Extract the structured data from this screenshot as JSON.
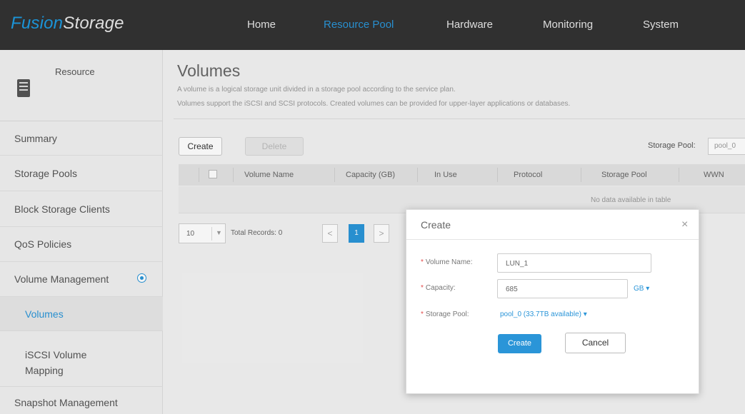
{
  "app": {
    "logo_part1": "Fusion",
    "logo_part2": "Storage"
  },
  "nav": {
    "items": [
      {
        "label": "Home",
        "active": false
      },
      {
        "label": "Resource Pool",
        "active": true
      },
      {
        "label": "Hardware",
        "active": false
      },
      {
        "label": "Monitoring",
        "active": false
      },
      {
        "label": "System",
        "active": false
      }
    ]
  },
  "sidebar": {
    "header_label": "Resource",
    "header_icon": "server-icon",
    "items": [
      {
        "label": "Summary"
      },
      {
        "label": "Storage Pools"
      },
      {
        "label": "Block Storage Clients"
      },
      {
        "label": "QoS Policies"
      },
      {
        "label": "Volume Management",
        "expand_icon": "expand-icon"
      },
      {
        "label": "Volumes",
        "selected": true
      },
      {
        "label": "iSCSI Volume Mapping"
      },
      {
        "label": "Snapshot Management"
      }
    ]
  },
  "main": {
    "title": "Volumes",
    "desc_line1": "A volume is a logical storage unit divided in a storage pool according to the service plan.",
    "desc_line2": "Volumes support the iSCSI and SCSI protocols. Created volumes can be provided for upper-layer applications or databases.",
    "create_label": "Create",
    "delete_label": "Delete",
    "storage_pool_label": "Storage Pool:",
    "storage_pool_value": "pool_0",
    "table": {
      "columns": [
        "Volume Name",
        "Capacity (GB)",
        "In Use",
        "Protocol",
        "Storage Pool",
        "WWN"
      ],
      "empty_text": "No data available in table"
    },
    "pager": {
      "page_size": "10",
      "total_text": "Total Records: 0",
      "current_page": "1",
      "prev": "<",
      "next": ">"
    }
  },
  "dialog": {
    "title": "Create",
    "close": "×",
    "fields": {
      "volume_name_label": "Volume Name:",
      "volume_name_value": "LUN_1",
      "capacity_label": "Capacity:",
      "capacity_value": "685",
      "capacity_unit": "GB ▾",
      "pool_label": "Storage Pool:",
      "pool_value": "pool_0 (33.7TB available) ▾"
    },
    "required_mark": "*",
    "create_label": "Create",
    "cancel_label": "Cancel"
  },
  "colors": {
    "accent": "#2a95d8",
    "topbar": "#323232",
    "required": "#e24a4a"
  }
}
